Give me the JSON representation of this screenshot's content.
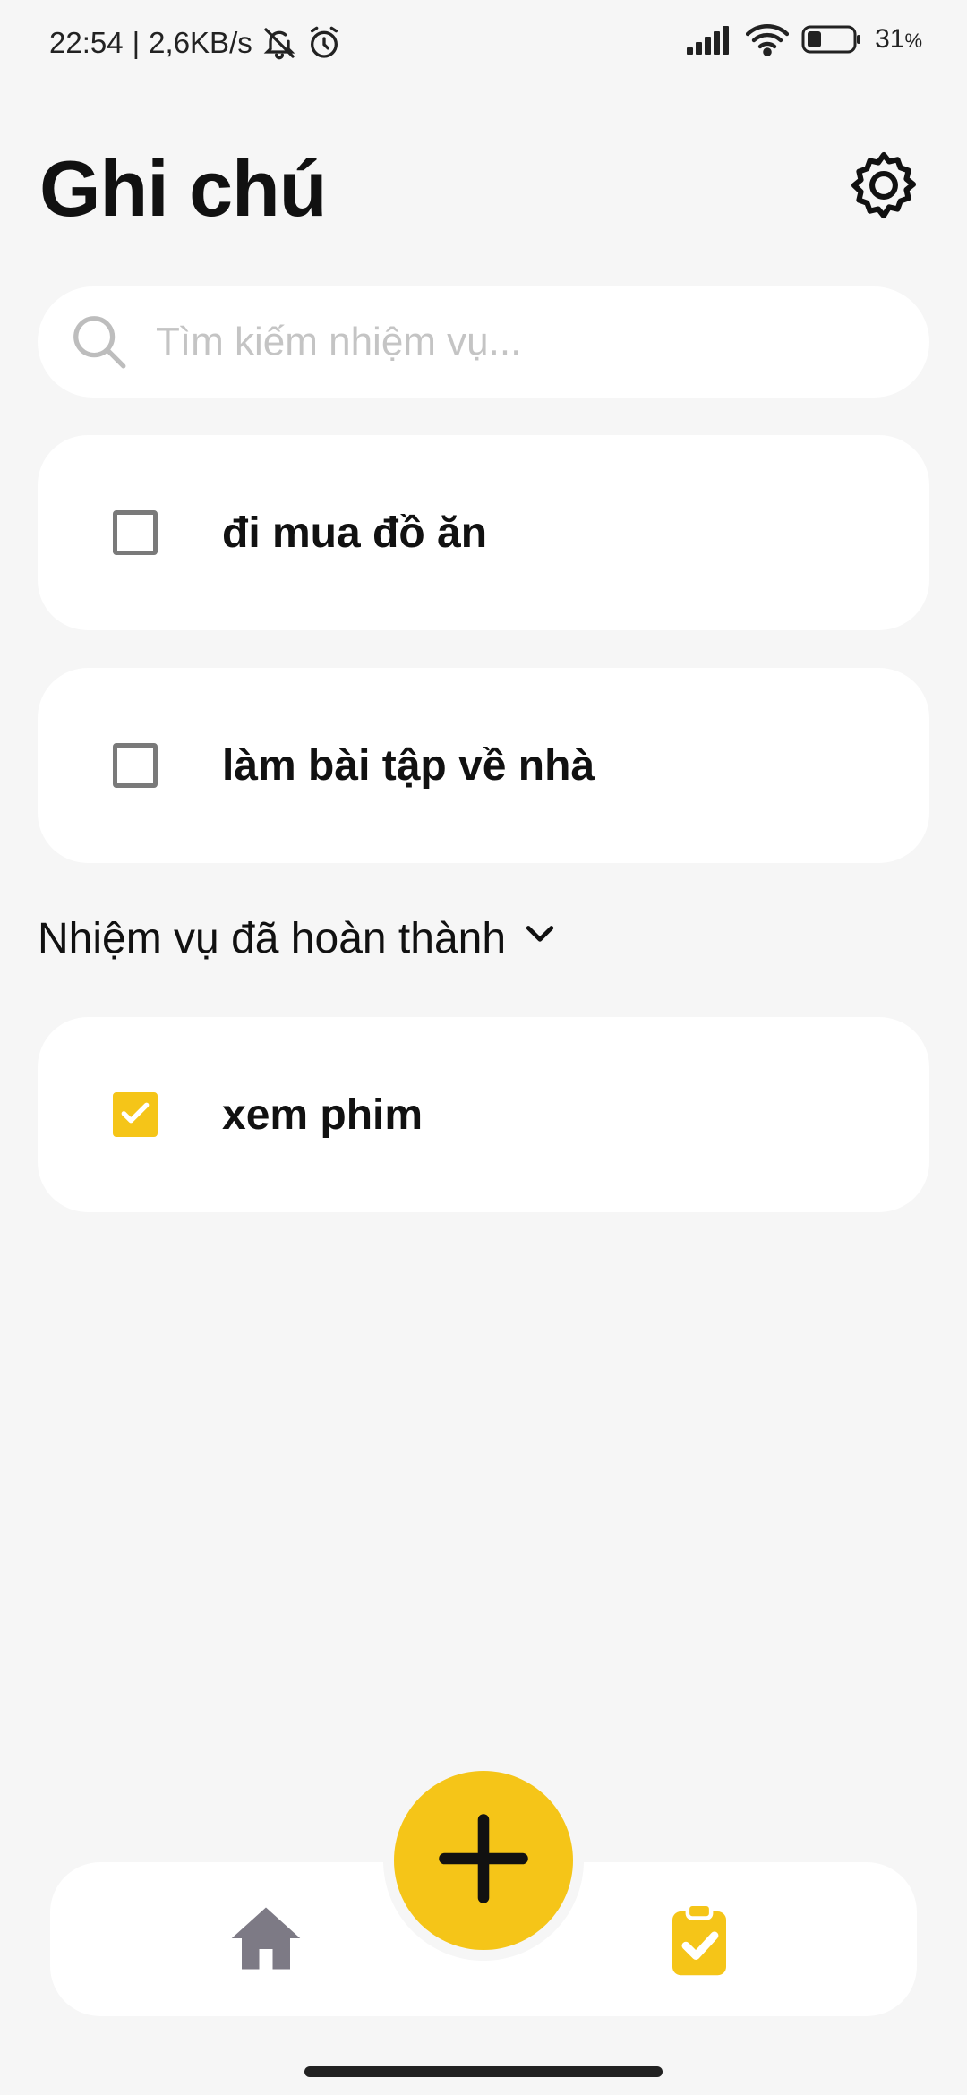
{
  "status_bar": {
    "time": "22:54",
    "separator": "|",
    "speed": "2,6KB/s",
    "battery": "31",
    "battery_unit": "%",
    "battery_level": 0.31
  },
  "header": {
    "title": "Ghi chú",
    "settings_icon": "gear-icon"
  },
  "search": {
    "placeholder": "Tìm kiếm nhiệm vụ...",
    "value": ""
  },
  "tasks": [
    {
      "label": "đi mua đồ ăn",
      "done": false
    },
    {
      "label": "làm bài tập về nhà",
      "done": false
    }
  ],
  "completed_section": {
    "label": "Nhiệm vụ đã hoàn thành",
    "expanded": true,
    "tasks": [
      {
        "label": "xem phim",
        "done": true
      }
    ]
  },
  "bottom_nav": {
    "items": [
      "home-icon",
      "clipboard-check-icon"
    ],
    "active": "clipboard-check-icon",
    "fab_icon": "plus-icon"
  },
  "colors": {
    "accent": "#f5c518",
    "background": "#f6f6f6",
    "inactive_icon": "#7d7a85"
  }
}
